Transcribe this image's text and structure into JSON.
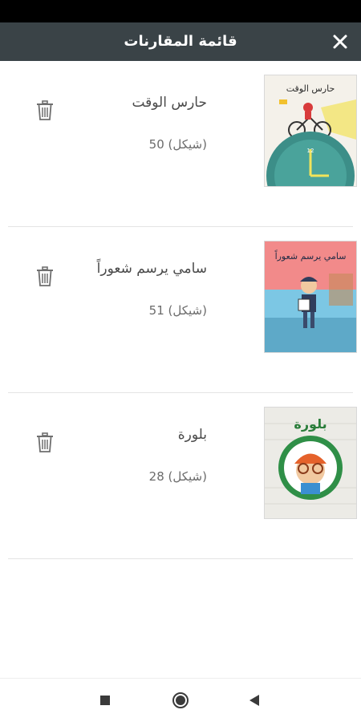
{
  "app": {
    "title": "قائمة المقارنات"
  },
  "items": [
    {
      "name": "حارس الوقت",
      "price": "50 (شيكل)",
      "cover_title": "حارس الوقت"
    },
    {
      "name": "سامي يرسم شعوراً",
      "price": "51 (شيكل)",
      "cover_title": "سامي يرسم شعوراً"
    },
    {
      "name": "بلورة",
      "price": "28 (شيكل)",
      "cover_title": "بلورة"
    }
  ],
  "icons": {
    "close": "close-icon",
    "delete": "trash-icon",
    "nav_recent": "square-icon",
    "nav_home": "circle-icon",
    "nav_back": "triangle-back-icon"
  },
  "colors": {
    "appbar": "#3a4347",
    "statusbar": "#000000",
    "text_primary": "#4a4a4a",
    "text_secondary": "#6b6b6b"
  }
}
